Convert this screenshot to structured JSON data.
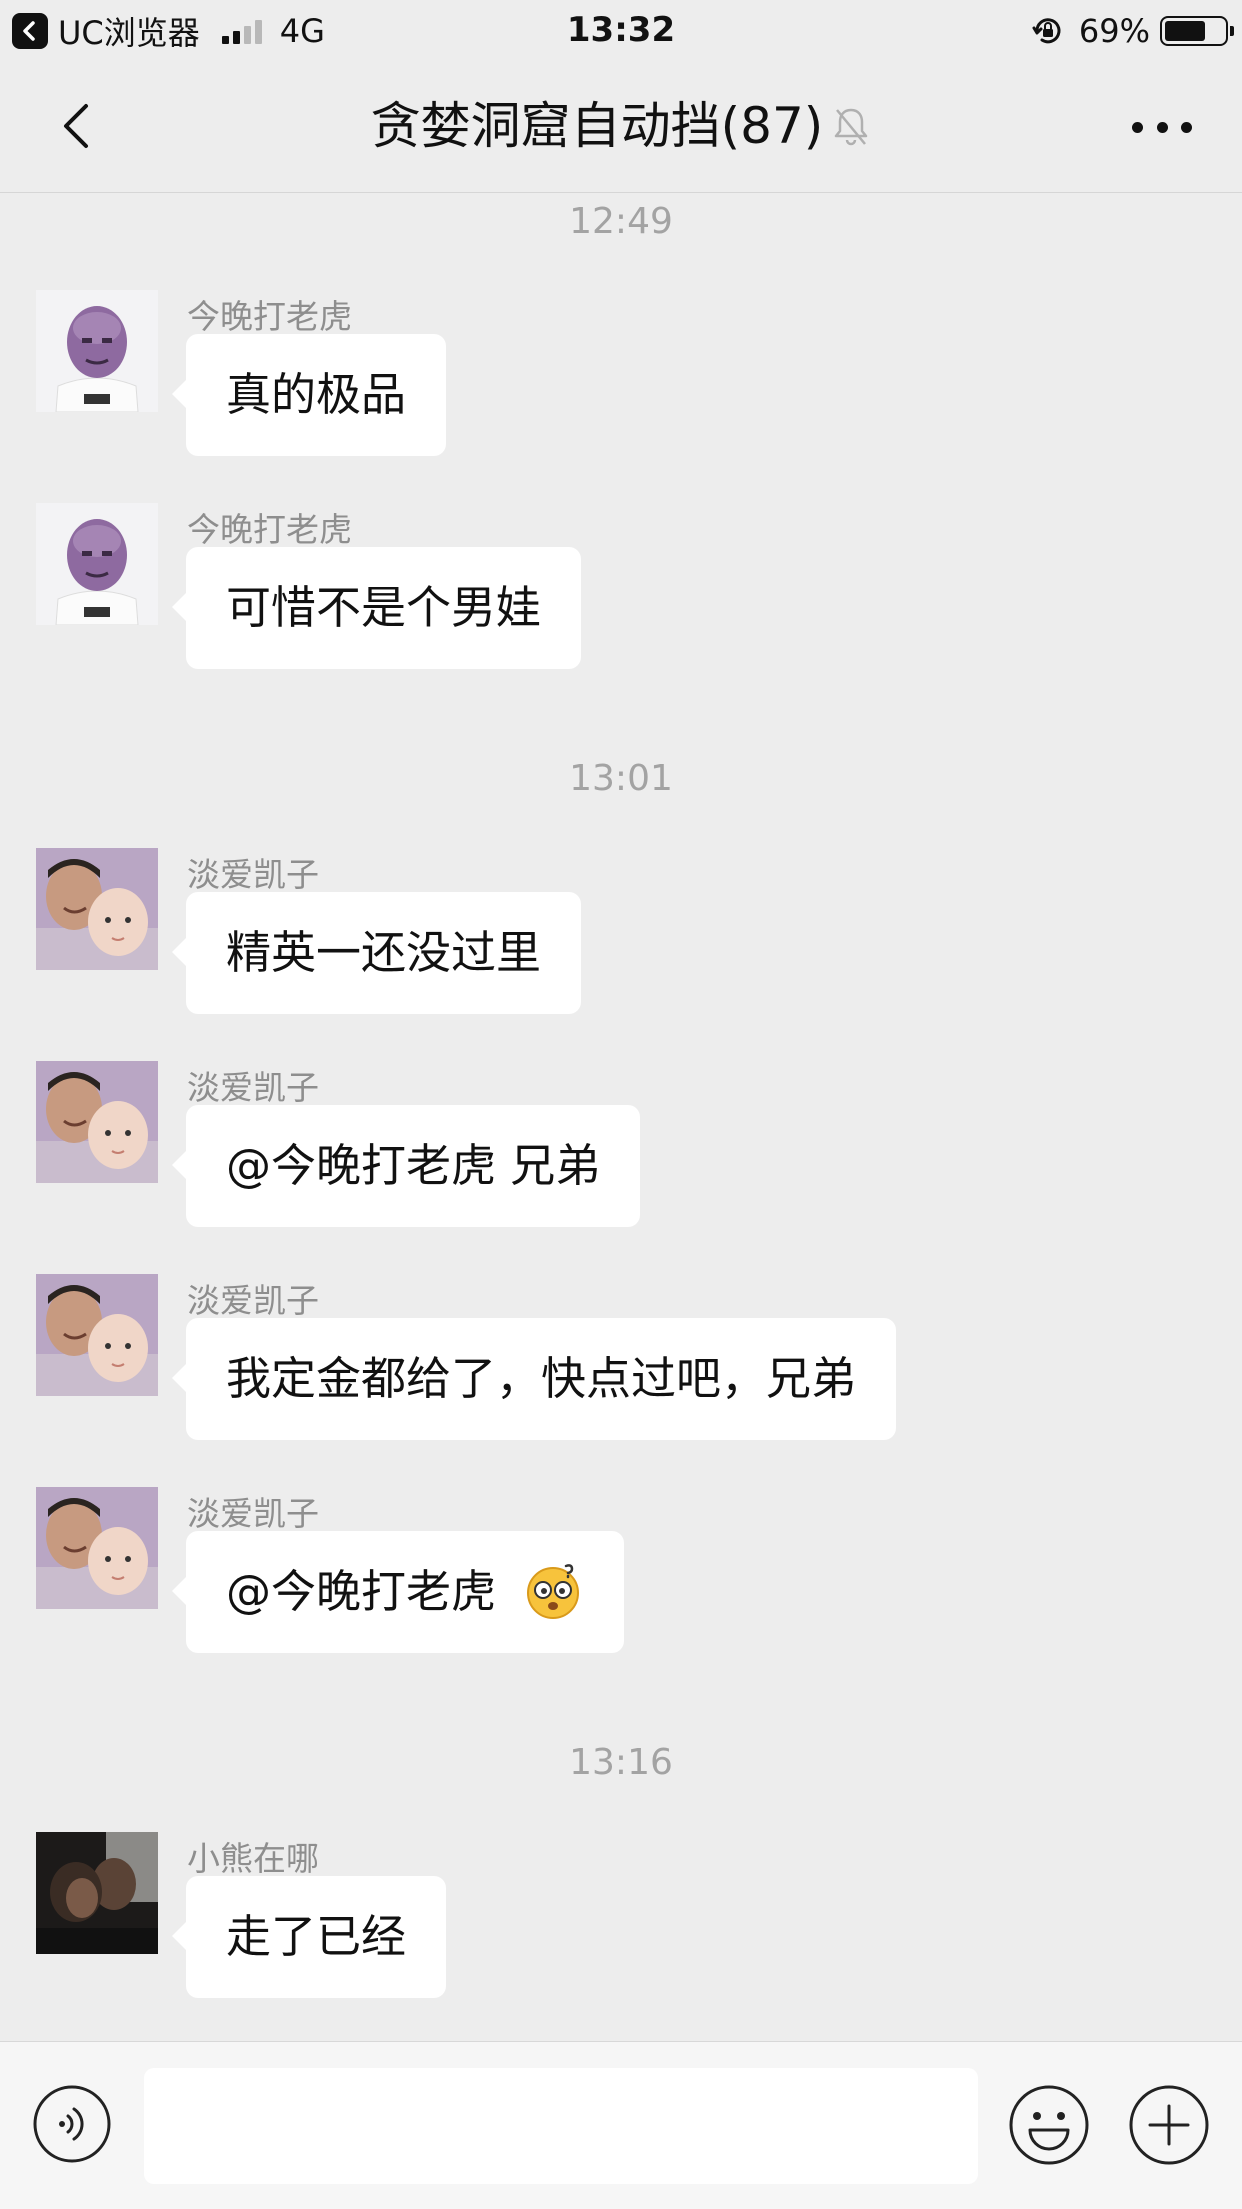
{
  "status_bar": {
    "app_label": "UC浏览器",
    "network": "4G",
    "time": "13:32",
    "battery": "69%",
    "battery_level": 0.69
  },
  "nav": {
    "title": "贪婪洞窟自动挡(87)",
    "back_icon": "chevron-left-icon",
    "mute_icon": "bell-off-icon",
    "more_icon": "more-dots-icon"
  },
  "timestamps": [
    "12:49",
    "13:01",
    "13:16"
  ],
  "messages": [
    {
      "sender": "今晚打老虎",
      "text": "真的极品",
      "avatar": "thanos-mask-avatar"
    },
    {
      "sender": "今晚打老虎",
      "text": "可惜不是个男娃",
      "avatar": "thanos-mask-avatar"
    },
    {
      "sender": "淡爱凯子",
      "text": "精英一还没过里",
      "avatar": "father-baby-avatar"
    },
    {
      "sender": "淡爱凯子",
      "text": "@今晚打老虎 兄弟",
      "avatar": "father-baby-avatar"
    },
    {
      "sender": "淡爱凯子",
      "text": "我定金都给了，快点过吧，兄弟",
      "avatar": "father-baby-avatar"
    },
    {
      "sender": "淡爱凯子",
      "text": "@今晚打老虎",
      "avatar": "father-baby-avatar",
      "emoji": "dizzy-face-emoji"
    },
    {
      "sender": "小熊在哪",
      "text": "走了已经",
      "avatar": "dark-photo-avatar"
    }
  ],
  "input_bar": {
    "placeholder": "",
    "voice_icon": "voice-icon",
    "emoji_icon": "smiley-icon",
    "plus_icon": "plus-icon"
  },
  "colors": {
    "background": "#ededed",
    "bubble": "#ffffff",
    "meta_text": "#a3a3a3"
  }
}
